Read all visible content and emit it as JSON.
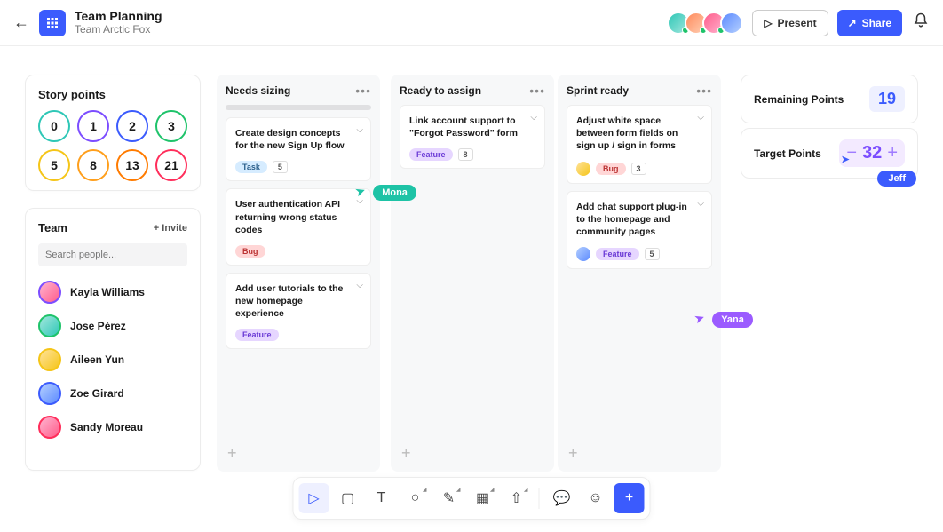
{
  "header": {
    "title": "Team Planning",
    "subtitle": "Team Arctic Fox",
    "present_label": "Present",
    "share_label": "Share",
    "avatars": [
      {
        "c1": "#2ec7b6",
        "c2": "#a3e7de"
      },
      {
        "c1": "#ff8a5b",
        "c2": "#ffd0b5"
      },
      {
        "c1": "#ff5b8a",
        "c2": "#ffb5d0"
      },
      {
        "c1": "#5b8aff",
        "c2": "#b5d0ff"
      }
    ]
  },
  "story_points": {
    "title": "Story points",
    "values": [
      {
        "n": "0",
        "color": "#2ec7b6"
      },
      {
        "n": "1",
        "color": "#7c4dff"
      },
      {
        "n": "2",
        "color": "#3b5bfd"
      },
      {
        "n": "3",
        "color": "#1ec36a"
      },
      {
        "n": "5",
        "color": "#f5c518"
      },
      {
        "n": "8",
        "color": "#ff9f1c"
      },
      {
        "n": "13",
        "color": "#ff7b00"
      },
      {
        "n": "21",
        "color": "#ff2e5b"
      }
    ]
  },
  "team": {
    "title": "Team",
    "invite_label": "+ Invite",
    "search_placeholder": "Search people...",
    "members": [
      {
        "name": "Kayla Williams",
        "ring": "#7c4dff",
        "c1": "#ffb5d0",
        "c2": "#ff5b8a"
      },
      {
        "name": "Jose Pérez",
        "ring": "#1ec36a",
        "c1": "#a3e7de",
        "c2": "#2ec7b6"
      },
      {
        "name": "Aileen Yun",
        "ring": "#f5c518",
        "c1": "#ffe29a",
        "c2": "#f5c518"
      },
      {
        "name": "Zoe Girard",
        "ring": "#3b5bfd",
        "c1": "#b5d0ff",
        "c2": "#5b8aff"
      },
      {
        "name": "Sandy Moreau",
        "ring": "#ff2e5b",
        "c1": "#ffb5d0",
        "c2": "#ff5b8a"
      }
    ]
  },
  "columns": [
    {
      "title": "Needs sizing",
      "show_progress": true,
      "cards": [
        {
          "text": "Create design concepts for the new Sign Up flow",
          "tag": "task",
          "tag_label": "Task",
          "count": "5"
        },
        {
          "text": "User authentication API returning wrong status codes",
          "tag": "bug",
          "tag_label": "Bug"
        },
        {
          "text": "Add user tutorials to the new homepage experience",
          "tag": "feature",
          "tag_label": "Feature"
        }
      ]
    },
    {
      "title": "Ready to assign",
      "cards": [
        {
          "text": "Link account support to \"Forgot Password\" form",
          "tag": "feature",
          "tag_label": "Feature",
          "count": "8"
        }
      ]
    },
    {
      "title": "Sprint ready",
      "cards": [
        {
          "text": "Adjust white space between form fields on sign up / sign in forms",
          "tag": "bug",
          "tag_label": "Bug",
          "count": "3",
          "avatar": {
            "c1": "#ffe29a",
            "c2": "#f5c518"
          }
        },
        {
          "text": "Add chat support plug-in to the homepage and community pages",
          "tag": "feature",
          "tag_label": "Feature",
          "count": "5",
          "avatar": {
            "c1": "#b5d0ff",
            "c2": "#5b8aff"
          }
        }
      ]
    }
  ],
  "stats": {
    "remaining_label": "Remaining Points",
    "remaining_value": "19",
    "target_label": "Target Points",
    "target_value": "32"
  },
  "cursors": {
    "mona": {
      "label": "Mona",
      "color": "#1ec3a6"
    },
    "yana": {
      "label": "Yana",
      "color": "#9b5bff"
    },
    "jeff": {
      "label": "Jeff"
    }
  },
  "toolbar": {
    "items": [
      {
        "name": "pointer",
        "active": true
      },
      {
        "name": "note"
      },
      {
        "name": "text"
      },
      {
        "name": "shape",
        "sup": true
      },
      {
        "name": "pen",
        "sup": true
      },
      {
        "name": "grid",
        "sup": true
      },
      {
        "name": "upload",
        "sup": true
      },
      {
        "name": "comment"
      },
      {
        "name": "sticker"
      },
      {
        "name": "add",
        "add": true
      }
    ]
  }
}
